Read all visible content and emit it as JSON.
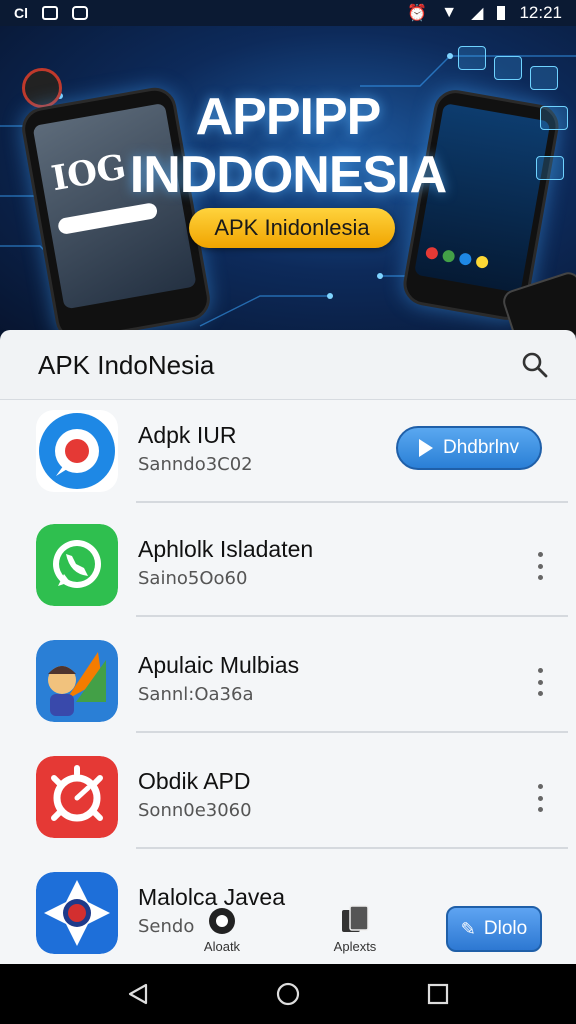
{
  "status_bar": {
    "time": "12:21"
  },
  "banner": {
    "title_line1": "APPIPP",
    "title_line2": "INDDONESIA",
    "pill_label": "APK Inidonlesia",
    "phone_clock": "IOG"
  },
  "header": {
    "title": "APK IndoNesia",
    "search_icon": "search-icon"
  },
  "apps": [
    {
      "name": "Adpk IUR",
      "subtitle": "Sanndo3C02",
      "action": "Dhdbrlnv",
      "icon": "browser-compass-icon",
      "colors": [
        "#1e88e5",
        "#e53935"
      ]
    },
    {
      "name": "Aphlolk Isladaten",
      "subtitle": "Saino5Oo60",
      "action": "",
      "icon": "phone-chat-icon",
      "colors": [
        "#34c759",
        "#1f9d3a"
      ]
    },
    {
      "name": "Apulaic Mulbias",
      "subtitle": "Sannl:Oa36a",
      "action": "",
      "icon": "avatar-arrow-icon",
      "colors": [
        "#2a7fd6",
        "#f57c00"
      ]
    },
    {
      "name": "Obdik APD",
      "subtitle": "Sonn0e3060",
      "action": "",
      "icon": "gear-target-icon",
      "colors": [
        "#e53935",
        "#ffffff"
      ]
    },
    {
      "name": "Malolca Javea",
      "subtitle": "Sendo",
      "action": "",
      "icon": "star-lens-icon",
      "colors": [
        "#1e6fd9",
        "#d32f2f"
      ]
    }
  ],
  "bottom_nav": [
    {
      "label": "Aloatk",
      "icon": "compass-icon"
    },
    {
      "label": "Aplexts",
      "icon": "files-icon"
    }
  ],
  "fab_label": "Dlolo"
}
